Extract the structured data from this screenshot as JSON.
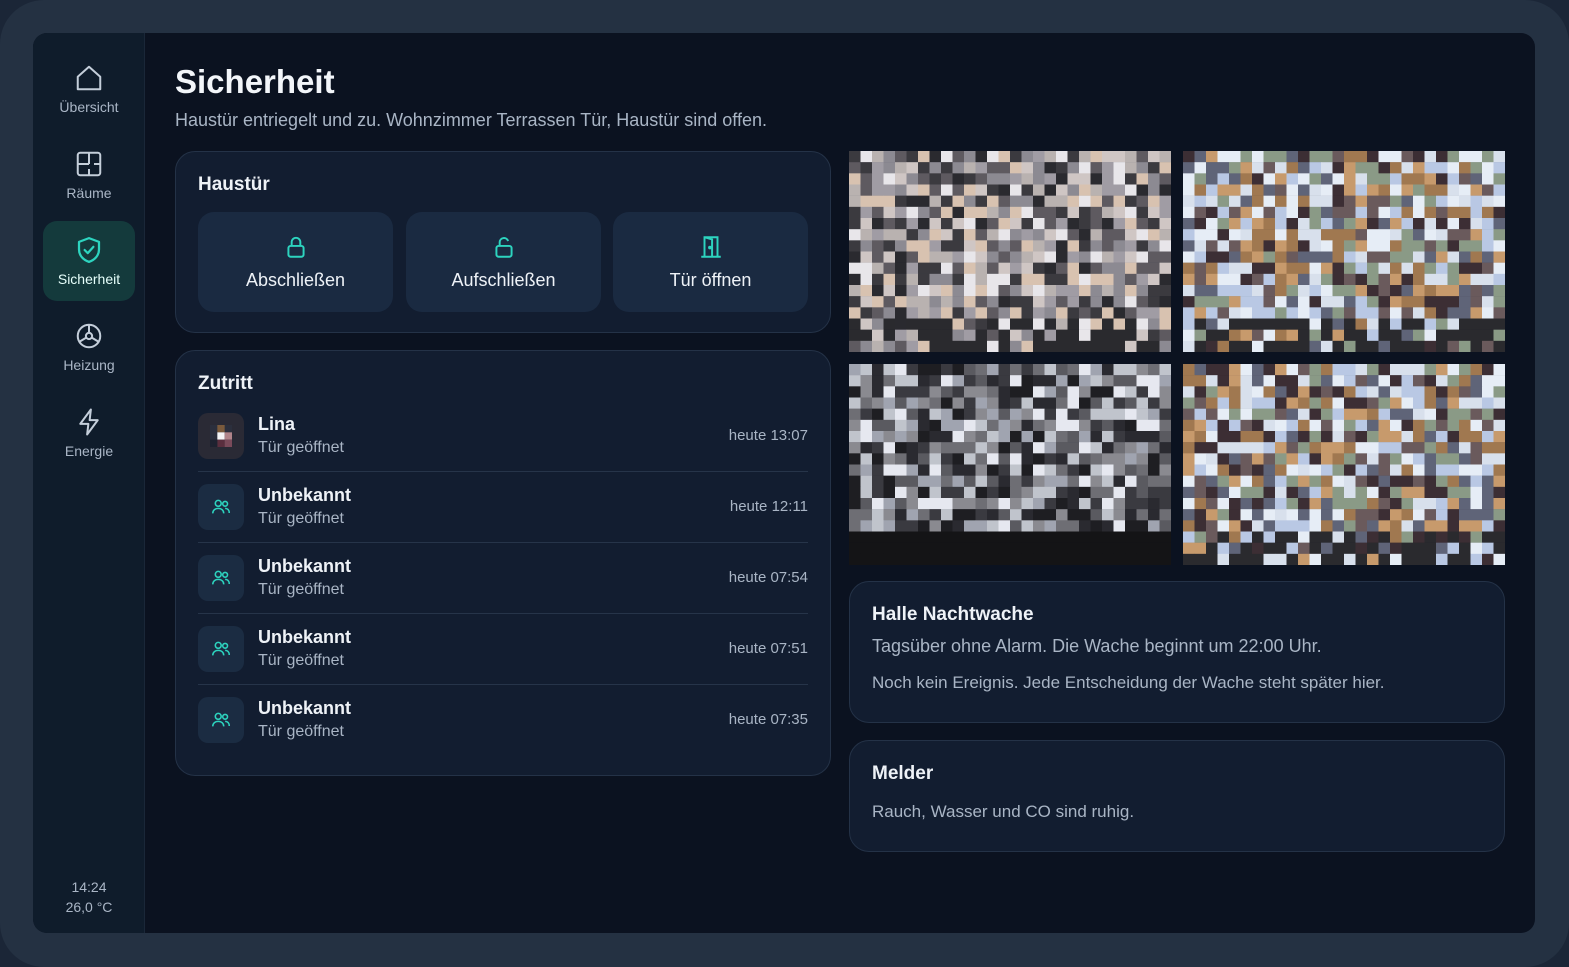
{
  "sidebar": {
    "items": [
      {
        "label": "Übersicht",
        "icon": "home-icon"
      },
      {
        "label": "Räume",
        "icon": "rooms-icon"
      },
      {
        "label": "Sicherheit",
        "icon": "shield-icon",
        "active": true
      },
      {
        "label": "Heizung",
        "icon": "heating-icon"
      },
      {
        "label": "Energie",
        "icon": "lightning-icon"
      }
    ],
    "time": "14:24",
    "temperature": "26,0 °C"
  },
  "header": {
    "title": "Sicherheit",
    "subtitle": "Haustür entriegelt und zu. Wohnzimmer Terrassen Tür, Haustür sind offen."
  },
  "door": {
    "title": "Haustür",
    "buttons": [
      {
        "label": "Abschließen",
        "icon": "lock-icon"
      },
      {
        "label": "Aufschließen",
        "icon": "unlock-icon"
      },
      {
        "label": "Tür öffnen",
        "icon": "door-icon"
      }
    ]
  },
  "access": {
    "title": "Zutritt",
    "entries": [
      {
        "name": "Lina",
        "detail": "Tür geöffnet",
        "time": "heute 13:07",
        "avatar": "photo"
      },
      {
        "name": "Unbekannt",
        "detail": "Tür geöffnet",
        "time": "heute 12:11",
        "avatar": "people-icon"
      },
      {
        "name": "Unbekannt",
        "detail": "Tür geöffnet",
        "time": "heute 07:54",
        "avatar": "people-icon"
      },
      {
        "name": "Unbekannt",
        "detail": "Tür geöffnet",
        "time": "heute 07:51",
        "avatar": "people-icon"
      },
      {
        "name": "Unbekannt",
        "detail": "Tür geöffnet",
        "time": "heute 07:35",
        "avatar": "people-icon"
      }
    ]
  },
  "cameras": [
    "camera-1",
    "camera-2",
    "camera-3",
    "camera-4"
  ],
  "nightwatch": {
    "title": "Halle Nachtwache",
    "line1": "Tagsüber ohne Alarm. Die Wache beginnt um 22:00 Uhr.",
    "line2": "Noch kein Ereignis. Jede Entscheidung der Wache steht später hier."
  },
  "detectors": {
    "title": "Melder",
    "text": "Rauch, Wasser und CO sind ruhig."
  },
  "colors": {
    "accent": "#2dd4bf",
    "background": "#0b1220",
    "card": "#121d30",
    "active_nav": "#143a3c"
  }
}
